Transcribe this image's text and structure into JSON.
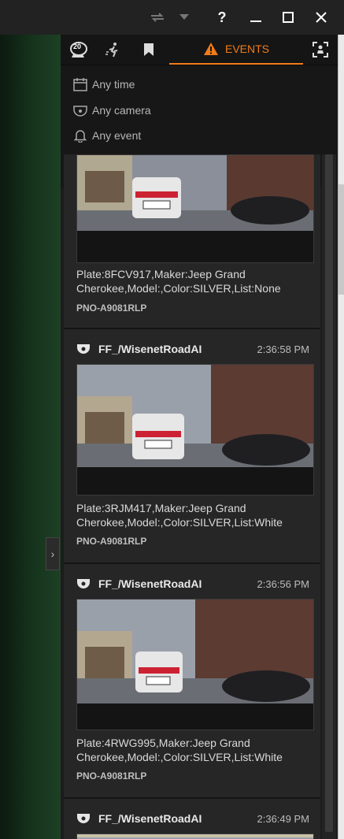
{
  "window": {
    "help_label": "?",
    "icons": [
      "refresh-icon",
      "chevron-down-icon",
      "minimize-icon",
      "maximize-icon",
      "close-icon"
    ]
  },
  "tabs": {
    "count_badge": "20",
    "events_label": "EVENTS",
    "active_color": "#f07c19"
  },
  "filters": {
    "time": "Any time",
    "camera": "Any camera",
    "event": "Any event"
  },
  "events": [
    {
      "camera": "",
      "time": "",
      "text": "Plate:8FCV917,Maker:Jeep Grand Cherokee,Model:,Color:SILVER,List:None",
      "plate_id": "PNO-A9081RLP"
    },
    {
      "camera": "FF_/WisenetRoadAI",
      "time": "2:36:58 PM",
      "text": "Plate:3RJM417,Maker:Jeep Grand Cherokee,Model:,Color:SILVER,List:White",
      "plate_id": "PNO-A9081RLP"
    },
    {
      "camera": "FF_/WisenetRoadAI",
      "time": "2:36:56 PM",
      "text": "Plate:4RWG995,Maker:Jeep Grand Cherokee,Model:,Color:SILVER,List:White",
      "plate_id": "PNO-A9081RLP"
    },
    {
      "camera": "FF_/WisenetRoadAI",
      "time": "2:36:49 PM",
      "text": "",
      "plate_id": ""
    }
  ]
}
